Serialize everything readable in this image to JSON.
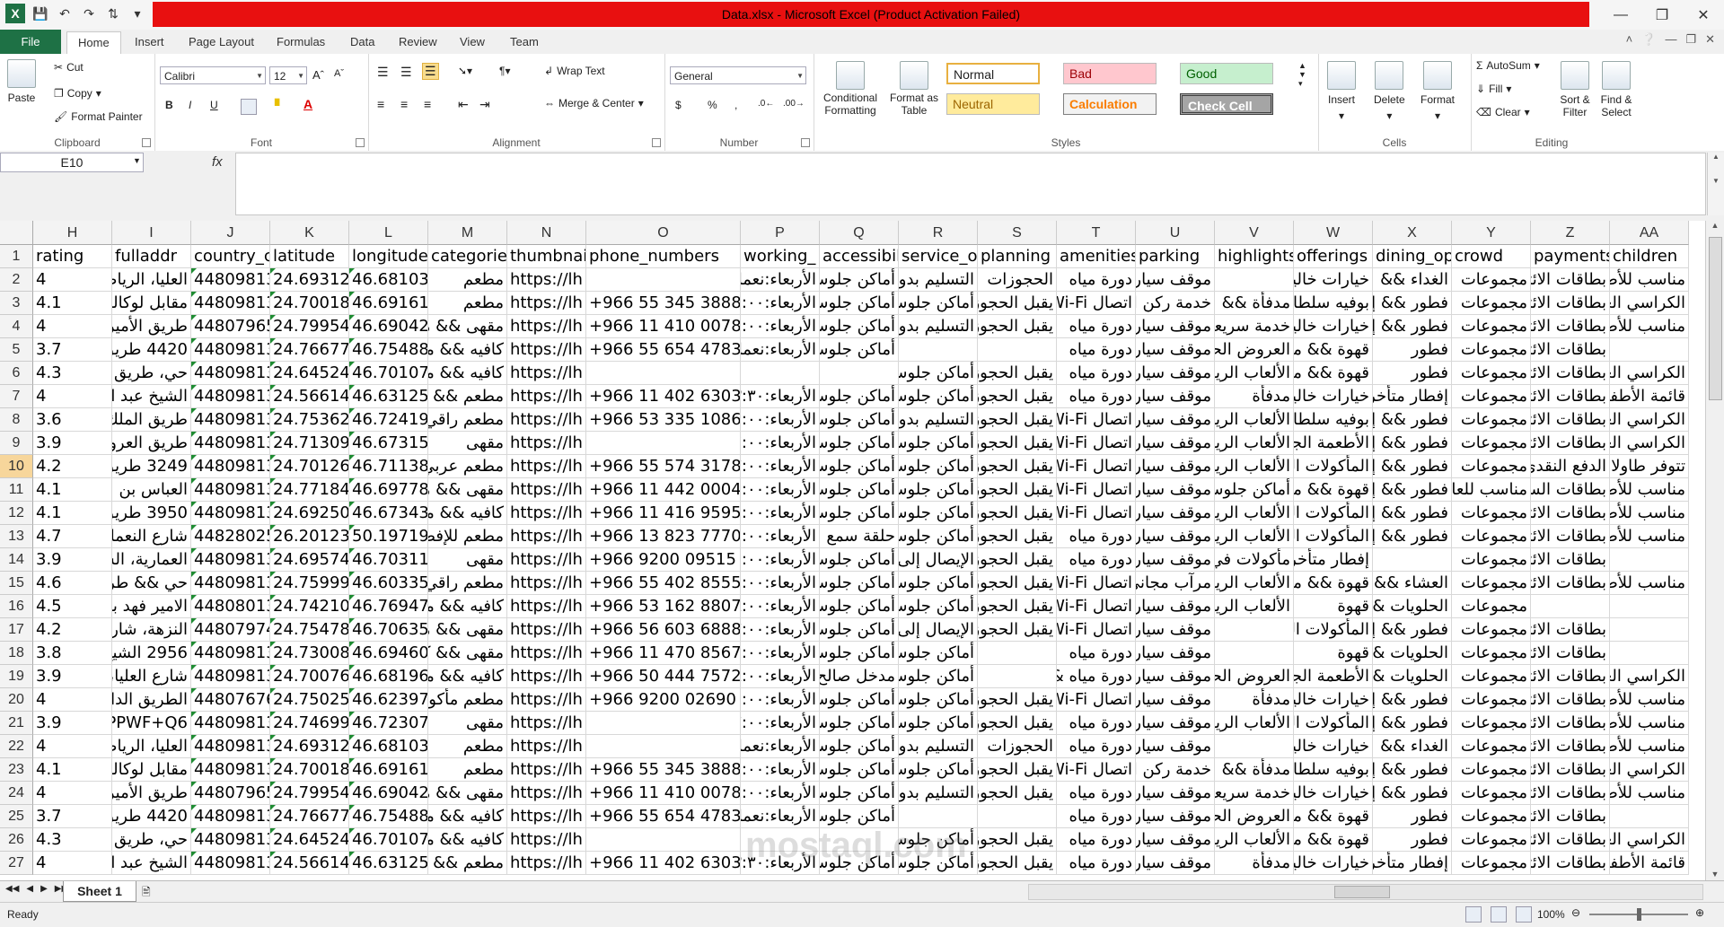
{
  "window": {
    "title": "Data.xlsx - Microsoft Excel (Product Activation Failed)"
  },
  "ribbon_tabs": [
    "File",
    "Home",
    "Insert",
    "Page Layout",
    "Formulas",
    "Data",
    "Review",
    "View",
    "Team"
  ],
  "clipboard": {
    "paste": "Paste",
    "cut": "Cut",
    "copy": "Copy",
    "format_painter": "Format Painter",
    "label": "Clipboard"
  },
  "font": {
    "name": "Calibri",
    "size": "12",
    "bold": "B",
    "italic": "I",
    "underline": "U",
    "label": "Font"
  },
  "alignment": {
    "wrap": "Wrap Text",
    "merge": "Merge & Center",
    "label": "Alignment"
  },
  "number": {
    "format": "General",
    "currency": "$",
    "percent": "%",
    "comma": ",",
    "label": "Number"
  },
  "styles": {
    "conditional": "Conditional Formatting",
    "format_table": "Format as Table",
    "normal": "Normal",
    "bad": "Bad",
    "good": "Good",
    "neutral": "Neutral",
    "calculation": "Calculation",
    "check_cell": "Check Cell",
    "label": "Styles"
  },
  "cells": {
    "insert": "Insert",
    "delete": "Delete",
    "format": "Format",
    "label": "Cells"
  },
  "editing": {
    "autosum": "AutoSum",
    "fill": "Fill",
    "clear": "Clear",
    "sort": "Sort & Filter",
    "find": "Find & Select",
    "label": "Editing"
  },
  "formula_bar": {
    "name_box": "E10",
    "fx": "fx",
    "content": ""
  },
  "columns": [
    {
      "letter": "H",
      "header": "rating"
    },
    {
      "letter": "I",
      "header": "fulladdr"
    },
    {
      "letter": "J",
      "header": "country_c"
    },
    {
      "letter": "K",
      "header": "latitude"
    },
    {
      "letter": "L",
      "header": "longitude"
    },
    {
      "letter": "M",
      "header": "categories"
    },
    {
      "letter": "N",
      "header": "thumbnai"
    },
    {
      "letter": "O",
      "header": "phone_numbers"
    },
    {
      "letter": "P",
      "header": "working_"
    },
    {
      "letter": "Q",
      "header": "accessibil"
    },
    {
      "letter": "R",
      "header": "service_o"
    },
    {
      "letter": "S",
      "header": "planning"
    },
    {
      "letter": "T",
      "header": "amenities"
    },
    {
      "letter": "U",
      "header": "parking"
    },
    {
      "letter": "V",
      "header": "highlights"
    },
    {
      "letter": "W",
      "header": "offerings"
    },
    {
      "letter": "X",
      "header": "dining_op"
    },
    {
      "letter": "Y",
      "header": "crowd"
    },
    {
      "letter": "Z",
      "header": "payments"
    },
    {
      "letter": "AA",
      "header": "children"
    }
  ],
  "rows": [
    {
      "n": "2",
      "c": [
        "4",
        "العليا، الرياض",
        "44809813",
        "24.693120",
        "46.681038",
        "مطعم",
        "https://lh",
        "",
        "الأربعاء:نعمل",
        "أماكن جلوس",
        "التسليم بدون",
        "الحجوزات",
        "دورة مياه",
        "موقف سيارات",
        "",
        "خيارات خالية",
        "الغداء &&",
        "مجموعات",
        "بطاقات الائتمان",
        "مناسب للأطفال"
      ]
    },
    {
      "n": "3",
      "c": [
        "4.1",
        "مقابل لوكاليز",
        "44809813",
        "24.700187",
        "46.691618",
        "مطعم",
        "https://lh",
        "+966 55 345 3888",
        "الأربعاء:٥:٠٠",
        "أماكن جلوس",
        "أماكن جلوس",
        "يقبل الحجوزات",
        "اتصال Wi-Fi",
        "خدمة ركن السيارات",
        "مدفأة &&",
        "بوفيه سلطات",
        "فطور && إفطار",
        "مجموعات",
        "بطاقات الائتمان",
        "الكراسي العالية"
      ]
    },
    {
      "n": "4",
      "c": [
        "4",
        "طريق الأمير",
        "44807965",
        "24.799545",
        "46.690426",
        "مقهى && مطعم",
        "https://lh",
        "+966 11 410 0078",
        "الأربعاء:٦:٠٠",
        "أماكن جلوس",
        "التسليم بدون",
        "يقبل الحجوزات",
        "دورة مياه",
        "موقف سيارات",
        "خدمة سريعة",
        "خيارات خالية",
        "فطور && إفطار",
        "مجموعات",
        "بطاقات الائتمان",
        "مناسب للأطفال"
      ]
    },
    {
      "n": "5",
      "c": [
        "3.7",
        "4420 طريق",
        "44809813",
        "24.766776",
        "46.754887",
        "كافيه && مقهى",
        "https://lh",
        "+966 55 654 4783",
        "الأربعاء:نعمل",
        "أماكن جلوس",
        "",
        "",
        "دورة مياه",
        "موقف سيارات",
        "العروض الحصرية",
        "قهوة && مأكولات",
        "فطور",
        "مجموعات",
        "بطاقات الائتمان",
        ""
      ]
    },
    {
      "n": "6",
      "c": [
        "4.3",
        "حي، طريق الملك",
        "44809813",
        "24.645245",
        "46.701077",
        "كافيه && مقهى",
        "https://lh",
        "",
        "",
        "",
        "أماكن جلوس",
        "يقبل الحجوزات",
        "دورة مياه",
        "موقف سيارات",
        "الألعاب الرياضية",
        "قهوة && مأكولات",
        "فطور",
        "مجموعات",
        "بطاقات الائتمان",
        "الكراسي العالية"
      ]
    },
    {
      "n": "7",
      "c": [
        "4",
        "الشيخ عبد الله",
        "44809813",
        "24.566147",
        "46.63125",
        "مطعم && كافيه",
        "https://lh",
        "+966 11 402 6303",
        "الأربعاء:٣:٣٠",
        "أماكن جلوس",
        "أماكن جلوس",
        "يقبل الحجوزات",
        "دورة مياه",
        "موقف سيارات",
        "مدفأة",
        "خيارات خالية",
        "إفطار متأخر",
        "مجموعات",
        "بطاقات الائتمان",
        "قائمة الأطفال"
      ]
    },
    {
      "n": "8",
      "c": [
        "3.6",
        "طريق الملك",
        "44809813",
        "24.753622",
        "46.724197",
        "مطعم راقي &&",
        "https://lh",
        "+966 53 335 1086",
        "الأربعاء:٥:٠٠",
        "أماكن جلوس",
        "التسليم بدون",
        "يقبل الحجوزات",
        "اتصال Wi-Fi",
        "موقف سيارات",
        "الألعاب الرياضية",
        "بوفيه سلطات",
        "فطور && إفطار",
        "مجموعات",
        "بطاقات الائتمان",
        "الكراسي العالية"
      ]
    },
    {
      "n": "9",
      "c": [
        "3.9",
        "طريق العروبة",
        "44809813",
        "24.713090",
        "46.673150",
        "مقهى",
        "https://lh",
        "",
        "الأربعاء:٢:٠٠",
        "أماكن جلوس",
        "أماكن جلوس",
        "يقبل الحجوزات",
        "اتصال Wi-Fi",
        "موقف سيارات",
        "الألعاب الرياضية",
        "الأطعمة الجاهزة",
        "فطور && إفطار",
        "مجموعات",
        "بطاقات الائتمان",
        "الكراسي العالية"
      ]
    },
    {
      "n": "10",
      "c": [
        "4.2",
        "3249 طريق",
        "44809813",
        "24.701265",
        "46.711385",
        "مطعم عربي",
        "https://lh",
        "+966 55 574 3178",
        "الأربعاء:٧:٠٠",
        "أماكن جلوس",
        "أماكن جلوس",
        "يقبل الحجوزات",
        "اتصال Wi-Fi",
        "موقف سيارات",
        "الألعاب الرياضية",
        "المأكولات الحلال",
        "فطور && إفطار",
        "مجموعات",
        "الدفع النقدي",
        "تتوفر طاولات"
      ]
    },
    {
      "n": "11",
      "c": [
        "4.1",
        "العباس بن عبد",
        "44809813",
        "24.771845",
        "46.697786",
        "مقهى && مطعم",
        "https://lh",
        "+966 11 442 0004",
        "الأربعاء:٦:٠٠",
        "أماكن جلوس",
        "أماكن جلوس",
        "يقبل الحجوزات",
        "اتصال Wi-Fi",
        "موقف سيارات",
        "أماكن جلوس",
        "قهوة && مأكولات",
        "فطور && إفطار",
        "مناسب للعائلات",
        "بطاقات السحب",
        "مناسب للأطفال"
      ]
    },
    {
      "n": "12",
      "c": [
        "4.1",
        "3950 طريق",
        "44809813",
        "24.692504",
        "46.673439",
        "كافيه && مقهى",
        "https://lh",
        "+966 11 416 9595",
        "الأربعاء:٦:٠٠",
        "أماكن جلوس",
        "أماكن جلوس",
        "يقبل الحجوزات",
        "اتصال Wi-Fi",
        "موقف سيارات",
        "الألعاب الرياضية",
        "المأكولات الحلال",
        "فطور && إفطار",
        "مجموعات",
        "بطاقات الائتمان",
        "مناسب للأطفال"
      ]
    },
    {
      "n": "13",
      "c": [
        "4.7",
        "شارع النعمان",
        "44828025",
        "26.201237",
        "50.197196",
        "مطعم للإفطار",
        "https://lh",
        "+966 13 823 7770",
        "الأربعاء:٦:٠٠",
        "حلقة سمع",
        "أماكن جلوس",
        "يقبل الحجوزات",
        "دورة مياه",
        "موقف سيارات",
        "الألعاب الرياضية",
        "المأكولات الحلال",
        "فطور && إفطار",
        "مجموعات",
        "بطاقات الائتمان",
        "مناسب للأطفال"
      ]
    },
    {
      "n": "14",
      "c": [
        "3.9",
        "العمارية، السعودية",
        "44809813",
        "24.695742",
        "46.703113",
        "مقهى",
        "https://lh",
        "+966 9200 09515",
        "الأربعاء:٥:٠٠",
        "أماكن جلوس",
        "الإيصال إلى",
        "يقبل الحجوزات",
        "دورة مياه",
        "موقف سيارات",
        "مأكولات في",
        "إفطار متأخر",
        "",
        "مجموعات",
        "بطاقات الائتمان",
        ""
      ]
    },
    {
      "n": "15",
      "c": [
        "4.6",
        "حي && طريق",
        "44809813",
        "24.759997",
        "46.603359",
        "مطعم راقي &&",
        "https://lh",
        "+966 55 402 8555",
        "الأربعاء:٥:٠٠",
        "أماكن جلوس",
        "أماكن جلوس",
        "يقبل الحجوزات",
        "اتصال Wi-Fi",
        "مرآب مجاني",
        "الألعاب الرياضية",
        "قهوة && مأكولات",
        "العشاء &&",
        "مجموعات",
        "بطاقات الائتمان",
        "مناسب للأطفال"
      ]
    },
    {
      "n": "16",
      "c": [
        "4.5",
        "الامير فهد بن",
        "44808013",
        "24.742107",
        "46.76947",
        "كافيه && مقهى",
        "https://lh",
        "+966 53 162 8807",
        "الأربعاء:٨:٠٠",
        "أماكن جلوس",
        "أماكن جلوس",
        "يقبل الحجوزات",
        "اتصال Wi-Fi",
        "موقف سيارات",
        "الألعاب الرياضية",
        "قهوة",
        "الحلويات &&",
        "مجموعات",
        "",
        ""
      ]
    },
    {
      "n": "17",
      "c": [
        "4.2",
        "النزهة، شارع",
        "44807974",
        "24.754784",
        "46.706357",
        "مقهى && مطعم",
        "https://lh",
        "+966 56 603 6888",
        "الأربعاء:٧:٠٠",
        "أماكن جلوس",
        "الإيصال إلى",
        "يقبل الحجوزات",
        "اتصال Wi-Fi",
        "موقف سيارات",
        "",
        "المأكولات الحلال",
        "فطور && إفطار",
        "مجموعات",
        "بطاقات الائتمان",
        ""
      ]
    },
    {
      "n": "18",
      "c": [
        "3.8",
        "2956 الشيخ",
        "44809813",
        "24.730084",
        "46.694602",
        "مقهى && كافيه",
        "https://lh",
        "+966 11 470 8567",
        "الأربعاء:٦:٠٠",
        "أماكن جلوس",
        "أماكن جلوس",
        "",
        "دورة مياه",
        "موقف سيارات",
        "",
        "قهوة",
        "الحلويات &&",
        "مجموعات",
        "بطاقات الائتمان",
        ""
      ]
    },
    {
      "n": "19",
      "c": [
        "3.9",
        "شارع العليا،",
        "44809813",
        "24.700765",
        "46.681965",
        "كافيه && مقهى",
        "https://lh",
        "+966 50 444 7572",
        "الأربعاء:٨:٠٠",
        "مدخل صالح",
        "أماكن جلوس",
        "",
        "دورة مياه &&",
        "موقف سيارات",
        "العروض الحصرية",
        "الأطعمة الجاهزة",
        "الحلويات &&",
        "مجموعات",
        "بطاقات الائتمان",
        "الكراسي العالية"
      ]
    },
    {
      "n": "20",
      "c": [
        "4",
        "الطريق الدائري",
        "44807676",
        "24.750258",
        "46.623978",
        "مطعم مأكولات",
        "https://lh",
        "+966 9200 02690",
        "الأربعاء:٦:٠٠",
        "أماكن جلوس",
        "أماكن جلوس",
        "يقبل الحجوزات",
        "اتصال Wi-Fi",
        "موقف سيارات",
        "مدفأة",
        "خيارات خالية",
        "فطور && إفطار",
        "مجموعات",
        "بطاقات الائتمان",
        "مناسب للأطفال"
      ]
    },
    {
      "n": "21",
      "c": [
        "3.9",
        "PPWF+Q6",
        "44809813",
        "24.746993",
        "46.723079",
        "مقهى",
        "https://lh",
        "",
        "الأربعاء:٧:٠٠",
        "أماكن جلوس",
        "أماكن جلوس",
        "يقبل الحجوزات",
        "دورة مياه",
        "موقف سيارات",
        "الألعاب الرياضية",
        "المأكولات الحلال",
        "فطور && إفطار",
        "مجموعات",
        "بطاقات الائتمان",
        "مناسب للأطفال"
      ]
    },
    {
      "n": "22",
      "c": [
        "4",
        "العليا، الرياض",
        "44809813",
        "24.693120",
        "46.681038",
        "مطعم",
        "https://lh",
        "",
        "الأربعاء:نعمل",
        "أماكن جلوس",
        "التسليم بدون",
        "الحجوزات",
        "دورة مياه",
        "موقف سيارات",
        "",
        "خيارات خالية",
        "الغداء &&",
        "مجموعات",
        "بطاقات الائتمان",
        "مناسب للأطفال"
      ]
    },
    {
      "n": "23",
      "c": [
        "4.1",
        "مقابل لوكاليز",
        "44809813",
        "24.700187",
        "46.691618",
        "مطعم",
        "https://lh",
        "+966 55 345 3888",
        "الأربعاء:٥:٠٠",
        "أماكن جلوس",
        "أماكن جلوس",
        "يقبل الحجوزات",
        "اتصال Wi-Fi",
        "خدمة ركن السيارات",
        "مدفأة &&",
        "بوفيه سلطات",
        "فطور && إفطار",
        "مجموعات",
        "بطاقات الائتمان",
        "الكراسي العالية"
      ]
    },
    {
      "n": "24",
      "c": [
        "4",
        "طريق الأمير",
        "44807965",
        "24.799545",
        "46.690426",
        "مقهى && مطعم",
        "https://lh",
        "+966 11 410 0078",
        "الأربعاء:٦:٠٠",
        "أماكن جلوس",
        "التسليم بدون",
        "يقبل الحجوزات",
        "دورة مياه",
        "موقف سيارات",
        "خدمة سريعة",
        "خيارات خالية",
        "فطور && إفطار",
        "مجموعات",
        "بطاقات الائتمان",
        "مناسب للأطفال"
      ]
    },
    {
      "n": "25",
      "c": [
        "3.7",
        "4420 طريق",
        "44809813",
        "24.766776",
        "46.754887",
        "كافيه && مقهى",
        "https://lh",
        "+966 55 654 4783",
        "الأربعاء:نعمل",
        "أماكن جلوس",
        "",
        "",
        "دورة مياه",
        "موقف سيارات",
        "العروض الحصرية",
        "قهوة && مأكولات",
        "فطور",
        "مجموعات",
        "بطاقات الائتمان",
        ""
      ]
    },
    {
      "n": "26",
      "c": [
        "4.3",
        "حي، طريق الملك",
        "44809813",
        "24.645245",
        "46.701077",
        "كافيه && مقهى",
        "https://lh",
        "",
        "",
        "",
        "أماكن جلوس",
        "يقبل الحجوزات",
        "دورة مياه",
        "موقف سيارات",
        "الألعاب الرياضية",
        "قهوة && مأكولات",
        "فطور",
        "مجموعات",
        "بطاقات الائتمان",
        "الكراسي العالية"
      ]
    },
    {
      "n": "27",
      "c": [
        "4",
        "الشيخ عبد الله",
        "44809813",
        "24.566147",
        "46.63125",
        "مطعم && كافيه",
        "https://lh",
        "+966 11 402 6303",
        "الأربعاء:٣:٣٠",
        "أماكن جلوس",
        "أماكن جلوس",
        "يقبل الحجوزات",
        "دورة مياه",
        "موقف سيارات",
        "مدفأة",
        "خيارات خالية",
        "إفطار متأخر",
        "مجموعات",
        "بطاقات الائتمان",
        "قائمة الأطفال"
      ]
    }
  ],
  "sheet": {
    "tab": "Sheet 1"
  },
  "status": {
    "ready": "Ready",
    "zoom": "100%"
  },
  "watermark": "mostaql.com"
}
